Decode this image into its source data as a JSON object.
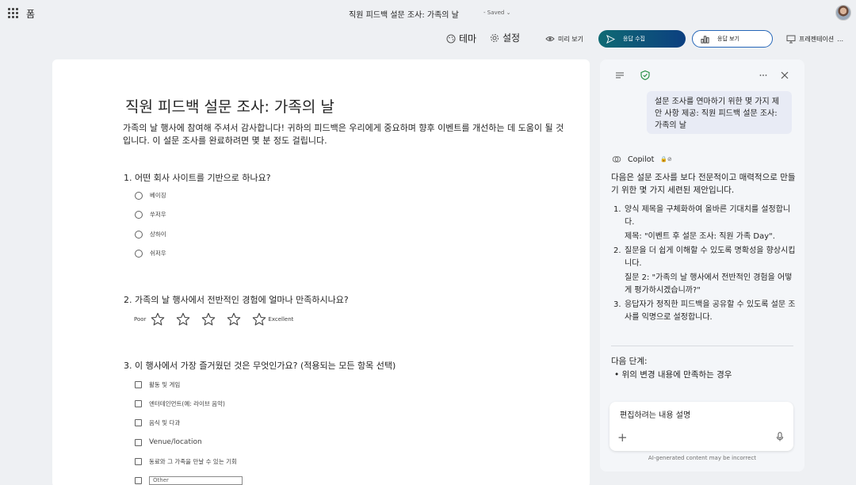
{
  "header": {
    "app_name": "폼",
    "doc_title": "직원 피드백 설문 조사: 가족의 날",
    "saved_label": "- Saved ⌄"
  },
  "toolbar": {
    "theme_label": "테마",
    "settings_label": "설정",
    "preview_label": "미리 보기",
    "collect_label": "응답 수집",
    "view_responses_label": "응답 보기",
    "present_label": "프레젠테이션"
  },
  "form": {
    "title": "직원 피드백 설문 조사: 가족의 날",
    "description": "가족의 날 행사에 참여해 주셔서 감사합니다! 귀하의 피드백은 우리에게 중요하며 향후 이벤트를 개선하는 데 도움이 될 것입니다. 이 설문 조사를 완료하려면 몇 분 정도 걸립니다.",
    "q1": {
      "title": "1. 어떤 회사 사이트를 기반으로 하나요?",
      "options": [
        "베이징",
        "쑤저우",
        "상하이",
        "쉬저우"
      ]
    },
    "q2": {
      "title": "2. 가족의 날 행사에서 전반적인 경험에 얼마나 만족하시나요?",
      "low_label": "Poor",
      "high_label": "Excellent",
      "stars": 5
    },
    "q3": {
      "title": "3. 이 행사에서 가장 즐거웠던 것은 무엇인가요? (적용되는 모든 항목 선택)",
      "options": [
        "활동 및 게임",
        "엔터테인먼트(예: 라이브 음악)",
        "음식 및 다과",
        "Venue/location",
        "동료와 그 가족을 만날 수 있는 기회"
      ],
      "other_placeholder": "Other"
    }
  },
  "copilot": {
    "user_message": "설문 조사를 연마하기 위한 몇 가지 제안 사항 제공: 직원 피드백 설문 조사: 가족의 날",
    "assistant_name": "Copilot",
    "intro": "다음은 설문 조사를 보다 전문적이고 매력적으로 만들기 위한 몇 가지 세련된 제안입니다.",
    "suggestions": [
      {
        "num": "1.",
        "text": "양식 제목을 구체화하여 올바른 기대치를 설정합니다.",
        "detail": "제목: \"이벤트 후 설문 조사: 직원 가족 Day\"."
      },
      {
        "num": "2.",
        "text": "질문을 더 쉽게 이해할 수 있도록 명확성을 향상시킵니다.",
        "detail": "질문 2: \"가족의 날 행사에서 전반적인 경험을 어떻게 평가하시겠습니까?\""
      },
      {
        "num": "3.",
        "text": "응답자가 정직한 피드백을 공유할 수 있도록 설문 조사를 익명으로 설정합니다.",
        "detail": ""
      }
    ],
    "next_steps_label": "다음 단계:",
    "next_bullet": "•  위의 변경 내용에 만족하는 경우",
    "input_placeholder": "편집하려는 내용 설명",
    "disclaimer": "AI-generated content may be incorrect"
  }
}
